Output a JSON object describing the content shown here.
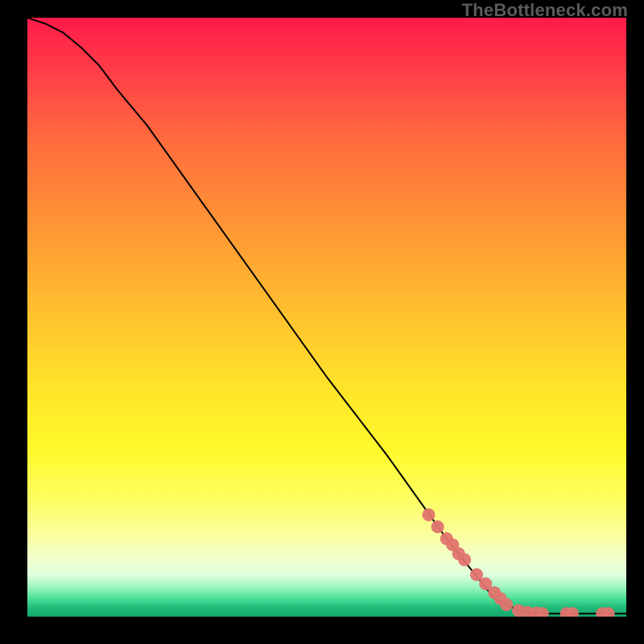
{
  "attribution": "TheBottleneck.com",
  "chart_data": {
    "type": "line",
    "title": "",
    "xlabel": "",
    "ylabel": "",
    "xlim": [
      0,
      100
    ],
    "ylim": [
      0,
      100
    ],
    "series": [
      {
        "name": "bottleneck-curve",
        "x": [
          0,
          3,
          6,
          9,
          12,
          15,
          20,
          30,
          40,
          50,
          60,
          70,
          78,
          82,
          84,
          86,
          88,
          90,
          94,
          98,
          100
        ],
        "y": [
          100,
          99,
          97.5,
          95,
          92,
          88,
          82,
          68,
          54,
          40,
          27,
          13,
          3,
          1,
          0.6,
          0.5,
          0.5,
          0.5,
          0.5,
          0.5,
          0.5
        ]
      }
    ],
    "markers": {
      "name": "highlighted-points",
      "x": [
        67,
        68.5,
        70,
        71,
        72,
        73,
        75,
        76.5,
        78,
        79,
        80,
        82,
        83.5,
        85,
        86,
        90,
        91,
        96,
        97
      ],
      "y": [
        17,
        15,
        13,
        12,
        10.5,
        9.5,
        7,
        5.5,
        4,
        3,
        2,
        1,
        0.7,
        0.6,
        0.5,
        0.5,
        0.5,
        0.5,
        0.5
      ]
    }
  },
  "colors": {
    "marker": "#e0746e",
    "curve": "#000000"
  }
}
